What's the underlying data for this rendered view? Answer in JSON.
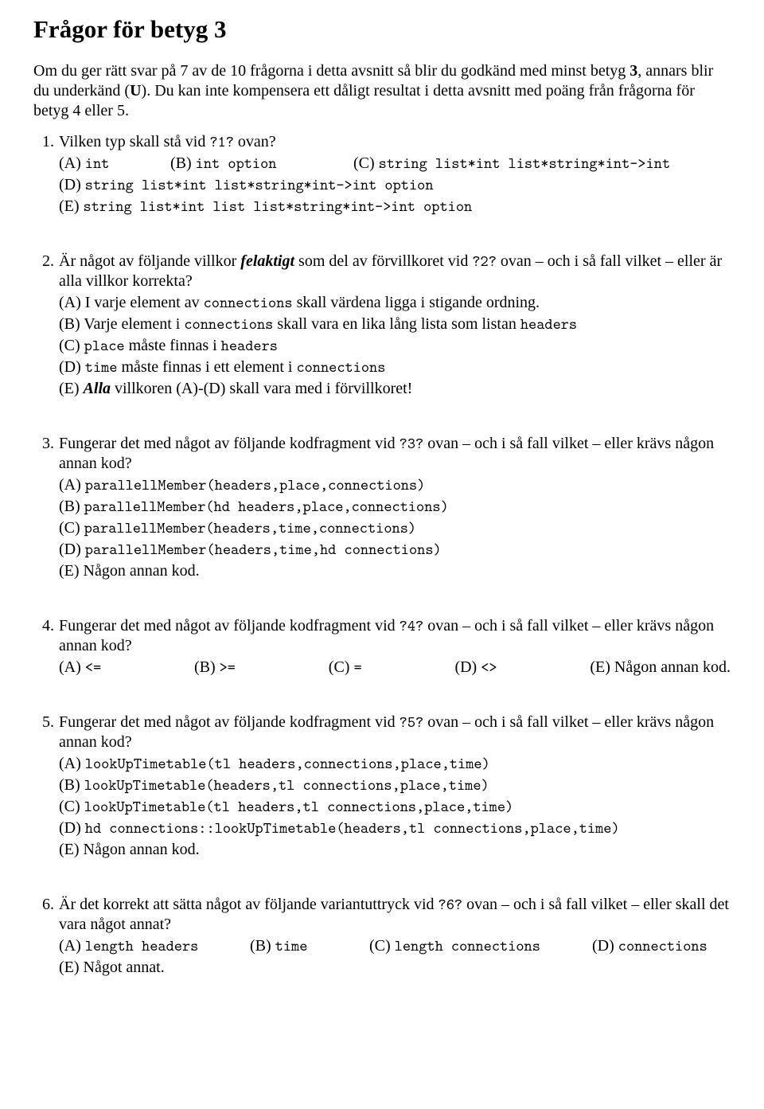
{
  "title": "Frågor för betyg 3",
  "intro": {
    "p1a": "Om du ger rätt svar på 7 av de 10 frågorna i detta avsnitt så blir du godkänd med minst betyg ",
    "p1b": "3",
    "p1c": ", annars blir du underkänd (",
    "p1d": "U",
    "p1e": "). Du kan inte kompensera ett dåligt resultat i detta avsnitt med poäng från frågorna för betyg 4 eller 5."
  },
  "q1": {
    "num": "1.",
    "text_a": "Vilken typ skall stå vid ",
    "text_b": "?1?",
    "text_c": " ovan?",
    "A_lab": "(A) ",
    "A_code": "int",
    "B_lab": "(B) ",
    "B_code": "int option",
    "C_lab": "(C) ",
    "C_code": "string list*int list*string*int->int",
    "D_lab": "(D) ",
    "D_code": "string list*int list*string*int->int option",
    "E_lab": "(E) ",
    "E_code": "string list*int list list*string*int->int option"
  },
  "q2": {
    "num": "2.",
    "text_a": "Är något av följande villkor ",
    "text_b": "felaktigt",
    "text_c": " som del av förvillkoret vid ",
    "text_d": "?2?",
    "text_e": " ovan – och i så fall vilket – eller är alla villkor korrekta?",
    "A_a": "(A) I varje element av ",
    "A_b": "connections",
    "A_c": " skall värdena ligga i stigande ordning.",
    "B_a": "(B) Varje element i ",
    "B_b": "connections",
    "B_c": " skall vara en lika lång lista som listan ",
    "B_d": "headers",
    "C_a": "(C) ",
    "C_b": "place",
    "C_c": " måste finnas i ",
    "C_d": "headers",
    "D_a": "(D) ",
    "D_b": "time",
    "D_c": " måste finnas i ett element i ",
    "D_d": "connections",
    "E_a": "(E) ",
    "E_b": "Alla",
    "E_c": " villkoren (A)-(D) skall vara med i förvillkoret!"
  },
  "q3": {
    "num": "3.",
    "text_a": "Fungerar det med något av följande kodfragment vid ",
    "text_b": "?3?",
    "text_c": " ovan – och i så fall vilket – eller krävs någon annan kod?",
    "A_lab": "(A) ",
    "A_code": "parallellMember(headers,place,connections)",
    "B_lab": "(B) ",
    "B_code": "parallellMember(hd headers,place,connections)",
    "C_lab": "(C) ",
    "C_code": "parallellMember(headers,time,connections)",
    "D_lab": "(D) ",
    "D_code": "parallellMember(headers,time,hd connections)",
    "E": "(E) Någon annan kod."
  },
  "q4": {
    "num": "4.",
    "text_a": "Fungerar det med något av följande kodfragment vid ",
    "text_b": "?4?",
    "text_c": " ovan – och i så fall vilket – eller krävs någon annan kod?",
    "A_lab": "(A) ",
    "A_code": "<=",
    "B_lab": "(B) ",
    "B_code": ">=",
    "C_lab": "(C) ",
    "C_code": "=",
    "D_lab": "(D) ",
    "D_code": "<>",
    "E": "(E) Någon annan kod."
  },
  "q5": {
    "num": "5.",
    "text_a": "Fungerar det med något av följande kodfragment vid ",
    "text_b": "?5?",
    "text_c": " ovan – och i så fall vilket – eller krävs någon annan kod?",
    "A_lab": "(A) ",
    "A_code": "lookUpTimetable(tl headers,connections,place,time)",
    "B_lab": "(B) ",
    "B_code": "lookUpTimetable(headers,tl connections,place,time)",
    "C_lab": "(C) ",
    "C_code": "lookUpTimetable(tl headers,tl connections,place,time)",
    "D_lab": "(D) ",
    "D_code": "hd connections::lookUpTimetable(headers,tl connections,place,time)",
    "E": "(E) Någon annan kod."
  },
  "q6": {
    "num": "6.",
    "text_a": "Är det korrekt att sätta något av följande variantuttryck vid ",
    "text_b": "?6?",
    "text_c": " ovan – och i så fall vilket – eller skall det vara något annat?",
    "A_lab": "(A) ",
    "A_code": "length headers",
    "B_lab": "(B) ",
    "B_code": "time",
    "C_lab": "(C) ",
    "C_code": "length connections",
    "D_lab": "(D) ",
    "D_code": "connections",
    "E": "(E) Något annat."
  }
}
